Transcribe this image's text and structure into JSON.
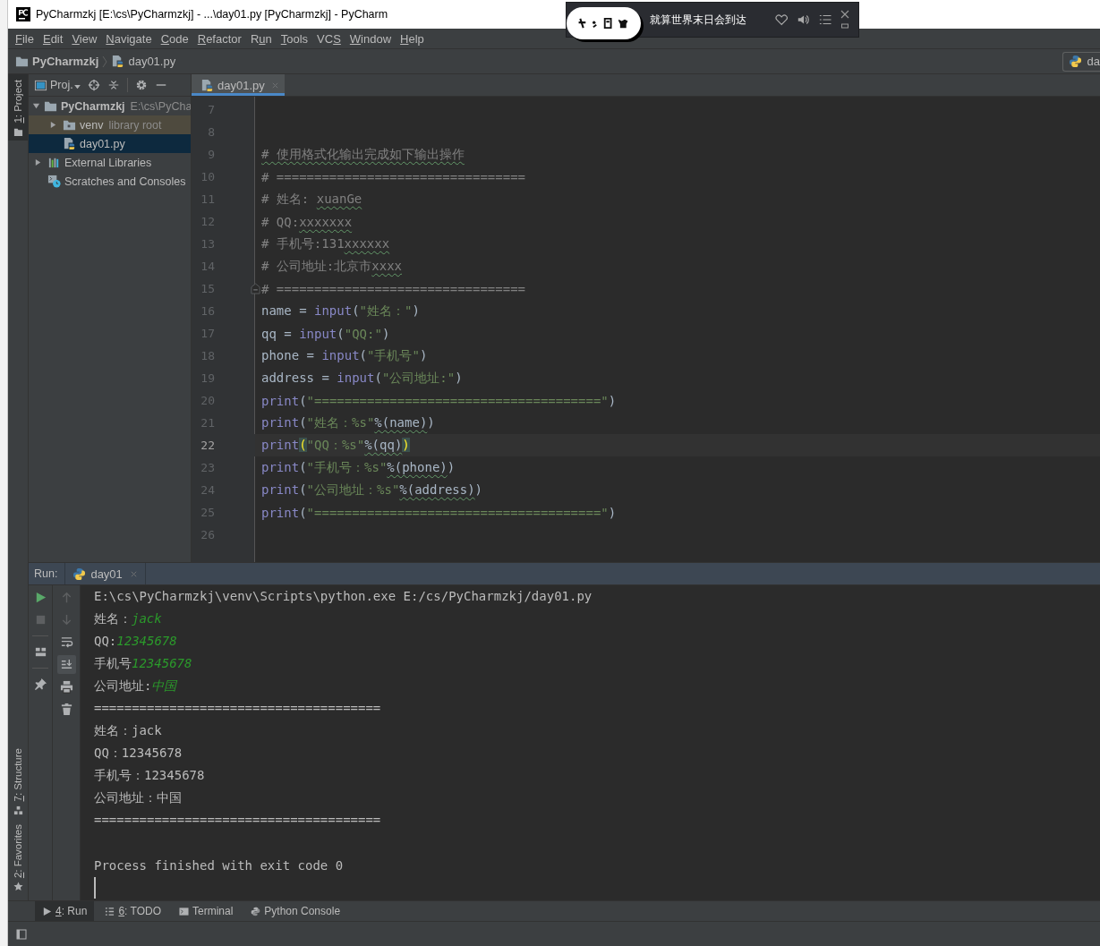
{
  "window": {
    "title": "PyCharmzkj [E:\\cs\\PyCharmzkj] - ...\\day01.py [PyCharmzkj] - PyCharm"
  },
  "music_player": {
    "song": "就算世界末日会到达"
  },
  "menu": [
    {
      "key": "F",
      "post": "ile"
    },
    {
      "key": "E",
      "post": "dit"
    },
    {
      "key": "V",
      "post": "iew"
    },
    {
      "key": "N",
      "post": "avigate"
    },
    {
      "key": "C",
      "post": "ode"
    },
    {
      "key": "R",
      "post": "efactor"
    },
    {
      "pre": "R",
      "key": "u",
      "post": "n"
    },
    {
      "key": "T",
      "post": "ools"
    },
    {
      "pre": "VC",
      "key": "S"
    },
    {
      "key": "W",
      "post": "indow"
    },
    {
      "key": "H",
      "post": "elp"
    }
  ],
  "breadcrumb": {
    "project": "PyCharmzkj",
    "file": "day01.py",
    "run_config": "da"
  },
  "tool_strip": {
    "top": [
      {
        "key": "1",
        "post": ": Project",
        "selected": true
      }
    ],
    "bottom": [
      {
        "key": "7",
        "post": ": Structure",
        "selected": false
      },
      {
        "key": "2",
        "post": ": Favorites",
        "selected": false
      }
    ]
  },
  "project_panel": {
    "view": "Proj.",
    "tree": [
      {
        "kind": "folder",
        "label": "PyCharmzkj",
        "hint": "E:\\cs\\PyCha",
        "expanded": true,
        "selected": false,
        "children": [
          {
            "kind": "library_folder",
            "label": "venv",
            "hint": "library root",
            "expanded": false,
            "selected": false
          },
          {
            "kind": "file",
            "label": "day01.py",
            "selected": true
          }
        ]
      },
      {
        "kind": "libraries",
        "label": "External Libraries",
        "expanded": false,
        "selected": false
      },
      {
        "kind": "scratches",
        "label": "Scratches and Consoles",
        "selected": false
      }
    ]
  },
  "editor": {
    "tabs": [
      {
        "label": "day01.py",
        "selected": true
      }
    ],
    "lines": [
      {
        "number": "7",
        "current": false,
        "fold": false
      },
      {
        "number": "8",
        "current": false,
        "fold": false
      },
      {
        "number": "9",
        "current": false,
        "fold": false,
        "segments": [
          {
            "kind": "comment_typo",
            "text": "# 使用格式化输出完成如下输出操作"
          }
        ]
      },
      {
        "number": "10",
        "current": false,
        "fold": false,
        "segments": [
          {
            "kind": "comment",
            "text": "# ================================="
          }
        ]
      },
      {
        "number": "11",
        "current": false,
        "fold": false,
        "segments": [
          {
            "kind": "comment",
            "text": "# 姓名: "
          },
          {
            "kind": "comment_typo",
            "text": "xuanGe"
          }
        ]
      },
      {
        "number": "12",
        "current": false,
        "fold": false,
        "segments": [
          {
            "kind": "comment",
            "text": "# QQ:"
          },
          {
            "kind": "comment_typo",
            "text": "xxxxxxx"
          }
        ]
      },
      {
        "number": "13",
        "current": false,
        "fold": false,
        "segments": [
          {
            "kind": "comment",
            "text": "# 手机号:131"
          },
          {
            "kind": "comment_typo",
            "text": "xxxxxx"
          }
        ]
      },
      {
        "number": "14",
        "current": false,
        "fold": false,
        "segments": [
          {
            "kind": "comment",
            "text": "# 公司地址:北京市"
          },
          {
            "kind": "comment_typo",
            "text": "xxxx"
          }
        ]
      },
      {
        "number": "15",
        "current": false,
        "fold": true,
        "segments": [
          {
            "kind": "comment",
            "text": "# ================================="
          }
        ]
      },
      {
        "number": "16",
        "current": false,
        "fold": false,
        "segments": [
          {
            "kind": "plain",
            "text": "name = "
          },
          {
            "kind": "builtin",
            "text": "input"
          },
          {
            "kind": "plain",
            "text": "("
          },
          {
            "kind": "string",
            "text": "\"姓名：\""
          },
          {
            "kind": "plain",
            "text": ")"
          }
        ]
      },
      {
        "number": "17",
        "current": false,
        "fold": false,
        "segments": [
          {
            "kind": "plain",
            "text": "qq = "
          },
          {
            "kind": "builtin",
            "text": "input"
          },
          {
            "kind": "plain",
            "text": "("
          },
          {
            "kind": "string",
            "text": "\"QQ:\""
          },
          {
            "kind": "plain",
            "text": ")"
          }
        ]
      },
      {
        "number": "18",
        "current": false,
        "fold": false,
        "segments": [
          {
            "kind": "plain",
            "text": "phone = "
          },
          {
            "kind": "builtin",
            "text": "input"
          },
          {
            "kind": "plain",
            "text": "("
          },
          {
            "kind": "string",
            "text": "\"手机号\""
          },
          {
            "kind": "plain",
            "text": ")"
          }
        ]
      },
      {
        "number": "19",
        "current": false,
        "fold": false,
        "segments": [
          {
            "kind": "plain",
            "text": "address = "
          },
          {
            "kind": "builtin",
            "text": "input"
          },
          {
            "kind": "plain",
            "text": "("
          },
          {
            "kind": "string",
            "text": "\"公司地址:\""
          },
          {
            "kind": "plain",
            "text": ")"
          }
        ]
      },
      {
        "number": "20",
        "current": false,
        "fold": false,
        "segments": [
          {
            "kind": "builtin",
            "text": "print"
          },
          {
            "kind": "plain",
            "text": "("
          },
          {
            "kind": "string",
            "text": "\"======================================\""
          },
          {
            "kind": "plain",
            "text": ")"
          }
        ]
      },
      {
        "number": "21",
        "current": false,
        "fold": false,
        "segments": [
          {
            "kind": "builtin",
            "text": "print"
          },
          {
            "kind": "plain",
            "text": "("
          },
          {
            "kind": "string",
            "text": "\"姓名：%s\""
          },
          {
            "kind": "typo",
            "text": "%(name)"
          },
          {
            "kind": "plain",
            "text": ")"
          }
        ]
      },
      {
        "number": "22",
        "current": true,
        "fold": false,
        "segments": [
          {
            "kind": "builtin",
            "text": "print"
          },
          {
            "kind": "brace_match",
            "text": "("
          },
          {
            "kind": "string",
            "text": "\"QQ：%s\""
          },
          {
            "kind": "typo",
            "text": "%(qq)"
          },
          {
            "kind": "brace_match",
            "text": ")"
          }
        ]
      },
      {
        "number": "23",
        "current": false,
        "fold": false,
        "segments": [
          {
            "kind": "builtin",
            "text": "print"
          },
          {
            "kind": "plain",
            "text": "("
          },
          {
            "kind": "string",
            "text": "\"手机号：%s\""
          },
          {
            "kind": "typo",
            "text": "%(phone)"
          },
          {
            "kind": "plain",
            "text": ")"
          }
        ]
      },
      {
        "number": "24",
        "current": false,
        "fold": false,
        "segments": [
          {
            "kind": "builtin",
            "text": "print"
          },
          {
            "kind": "plain",
            "text": "("
          },
          {
            "kind": "string",
            "text": "\"公司地址：%s\""
          },
          {
            "kind": "typo",
            "text": "%(address)"
          },
          {
            "kind": "plain",
            "text": ")"
          }
        ]
      },
      {
        "number": "25",
        "current": false,
        "fold": false,
        "segments": [
          {
            "kind": "builtin",
            "text": "print"
          },
          {
            "kind": "plain",
            "text": "("
          },
          {
            "kind": "string",
            "text": "\"======================================\""
          },
          {
            "kind": "plain",
            "text": ")"
          }
        ]
      },
      {
        "number": "26",
        "current": false,
        "fold": false
      }
    ]
  },
  "run_panel": {
    "label": "Run:",
    "tab": "day01",
    "output": [
      {
        "kind": "plain",
        "segments": [
          {
            "kind": "plain",
            "text": "E:\\cs\\PyCharmzkj\\venv\\Scripts\\python.exe E:/cs/PyCharmzkj/day01.py"
          }
        ]
      },
      {
        "kind": "plain",
        "segments": [
          {
            "kind": "plain",
            "text": "姓名："
          },
          {
            "kind": "input",
            "text": "jack"
          }
        ]
      },
      {
        "kind": "plain",
        "segments": [
          {
            "kind": "plain",
            "text": "QQ:"
          },
          {
            "kind": "input",
            "text": "12345678"
          }
        ]
      },
      {
        "kind": "plain",
        "segments": [
          {
            "kind": "plain",
            "text": "手机号"
          },
          {
            "kind": "input",
            "text": "12345678"
          }
        ]
      },
      {
        "kind": "plain",
        "segments": [
          {
            "kind": "plain",
            "text": "公司地址:"
          },
          {
            "kind": "input",
            "text": "中国"
          }
        ]
      },
      {
        "kind": "plain",
        "segments": [
          {
            "kind": "plain",
            "text": "======================================"
          }
        ]
      },
      {
        "kind": "plain",
        "segments": [
          {
            "kind": "plain",
            "text": "姓名：jack"
          }
        ]
      },
      {
        "kind": "plain",
        "segments": [
          {
            "kind": "plain",
            "text": "QQ：12345678"
          }
        ]
      },
      {
        "kind": "plain",
        "segments": [
          {
            "kind": "plain",
            "text": "手机号：12345678"
          }
        ]
      },
      {
        "kind": "plain",
        "segments": [
          {
            "kind": "plain",
            "text": "公司地址：中国"
          }
        ]
      },
      {
        "kind": "plain",
        "segments": [
          {
            "kind": "plain",
            "text": "======================================"
          }
        ]
      },
      {
        "kind": "exit",
        "segments": [
          {
            "kind": "plain",
            "text": "Process finished with exit code 0"
          }
        ]
      }
    ],
    "cursor": true
  },
  "bottom_tabs": [
    {
      "kind": "run",
      "key": "4",
      "post": ": Run",
      "selected": true
    },
    {
      "kind": "todo",
      "key": "6",
      "post": ": TODO",
      "selected": false
    },
    {
      "kind": "terminal",
      "post": "Terminal",
      "selected": false
    },
    {
      "kind": "python_console",
      "post": "Python Console",
      "selected": false
    }
  ]
}
